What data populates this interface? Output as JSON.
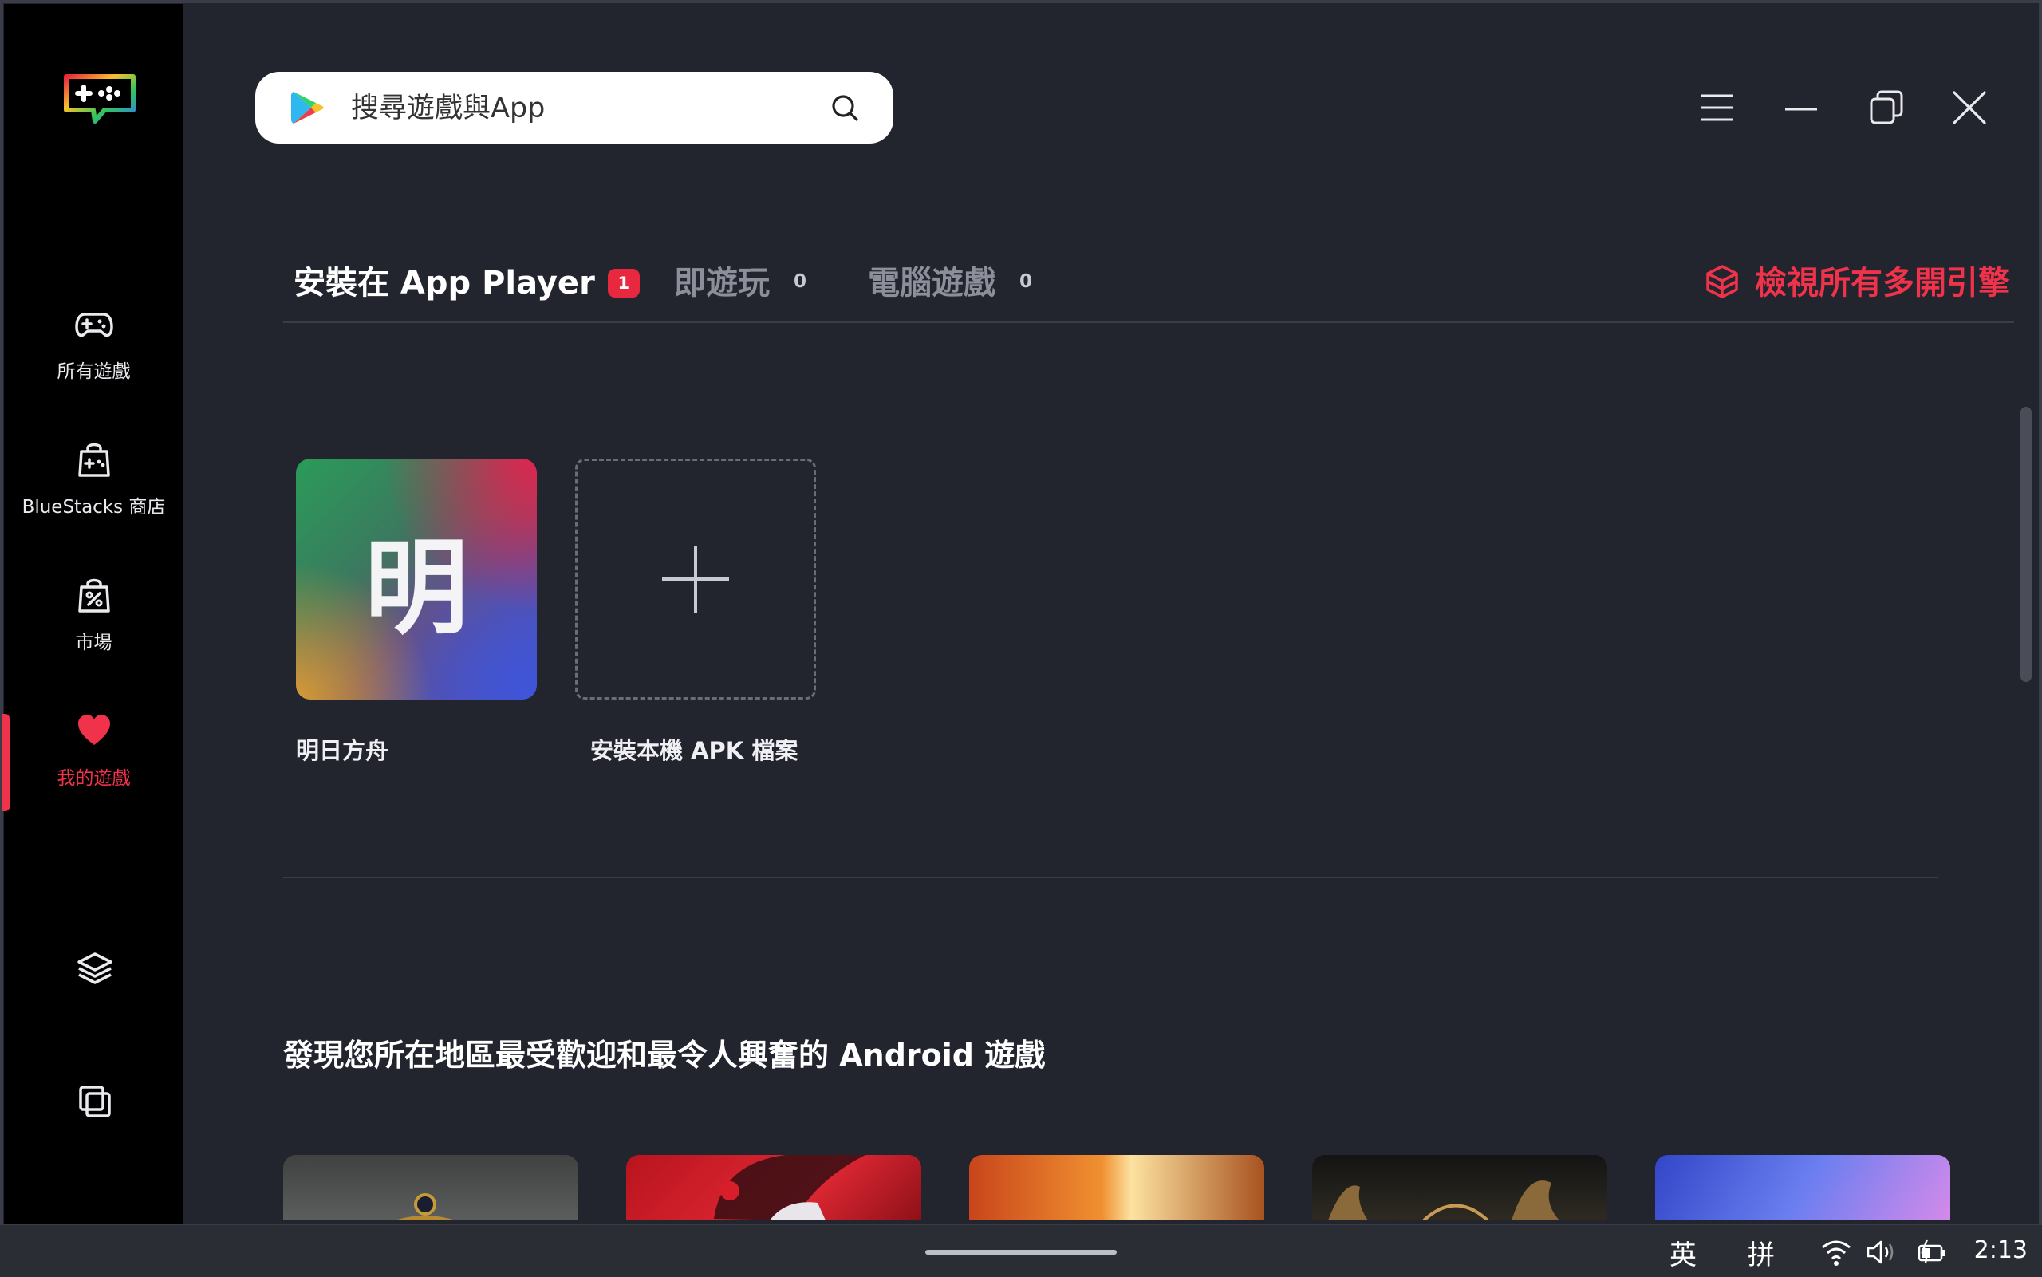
{
  "search": {
    "placeholder": "搜尋遊戲與App"
  },
  "sidebar": {
    "items": [
      {
        "label": "所有遊戲",
        "icon": "gamepad-icon"
      },
      {
        "label": "BlueStacks 商店",
        "icon": "store-bag-icon"
      },
      {
        "label": "市場",
        "icon": "discount-bag-icon"
      },
      {
        "label": "我的遊戲",
        "icon": "heart-icon",
        "active": true
      }
    ],
    "bottom_icons": [
      "layers-icon",
      "multi-window-icon"
    ]
  },
  "window_controls": [
    "menu-icon",
    "minimize-icon",
    "restore-icon",
    "close-icon"
  ],
  "tabs": [
    {
      "label": "安裝在 App Player",
      "badge": "1"
    },
    {
      "label": "即遊玩",
      "count": "0"
    },
    {
      "label": "電腦遊戲",
      "count": "0"
    }
  ],
  "multi_instance_link": "檢視所有多開引擎",
  "apps": [
    {
      "name": "明日方舟",
      "icon_glyph": "明"
    },
    {
      "name": "安裝本機 APK 檔案",
      "icon": "plus-icon"
    }
  ],
  "discover": {
    "title": "發現您所在地區最受歡迎和最令人興奮的 Android 遊戲"
  },
  "taskbar": {
    "ime_lang": "英",
    "ime_mode": "拼",
    "time": "2:13"
  },
  "colors": {
    "accent": "#f0324a",
    "bg": "#22242e",
    "sidebar": "#000000"
  }
}
